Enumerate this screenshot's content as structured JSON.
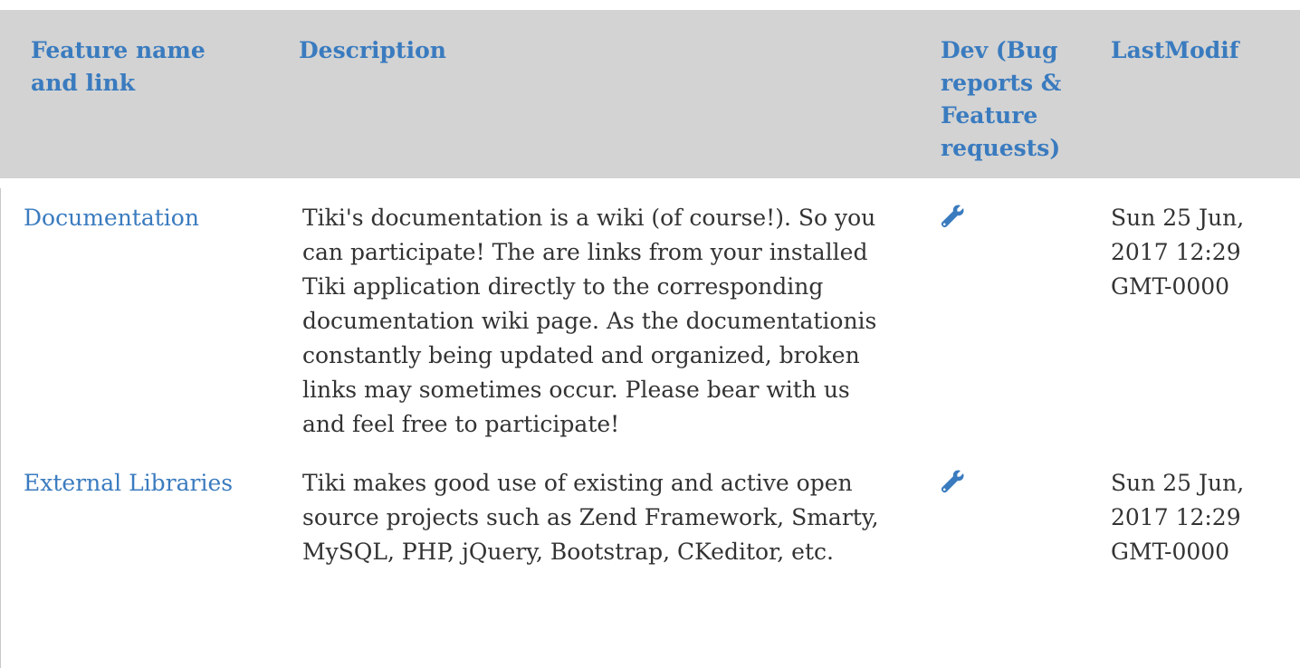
{
  "table": {
    "headers": {
      "name": "Feature name and link",
      "description": "Description",
      "dev": "Dev (Bug reports & Feature requests)",
      "last_modif": "LastModif"
    },
    "rows": [
      {
        "name": "Documentation",
        "description": "Tiki's documentation is a wiki (of course!). So you can participate! The are links from your installed Tiki application directly to the corresponding documentation wiki page. As the documentationis constantly being updated and organized, broken links may sometimes occur. Please bear with us and feel free to participate!",
        "dev_icon": "wrench-icon",
        "last_modif": "Sun 25 Jun, 2017 12:29 GMT-0000"
      },
      {
        "name": "External Libraries",
        "description": "Tiki makes good use of existing and active open source projects such as Zend Framework, Smarty, MySQL, PHP, jQuery, Bootstrap, CKeditor, etc.",
        "dev_icon": "wrench-icon",
        "last_modif": "Sun 25 Jun, 2017 12:29 GMT-0000"
      }
    ]
  },
  "colors": {
    "header_bg": "#d3d3d3",
    "link": "#3a7bbf",
    "text": "#333333"
  }
}
